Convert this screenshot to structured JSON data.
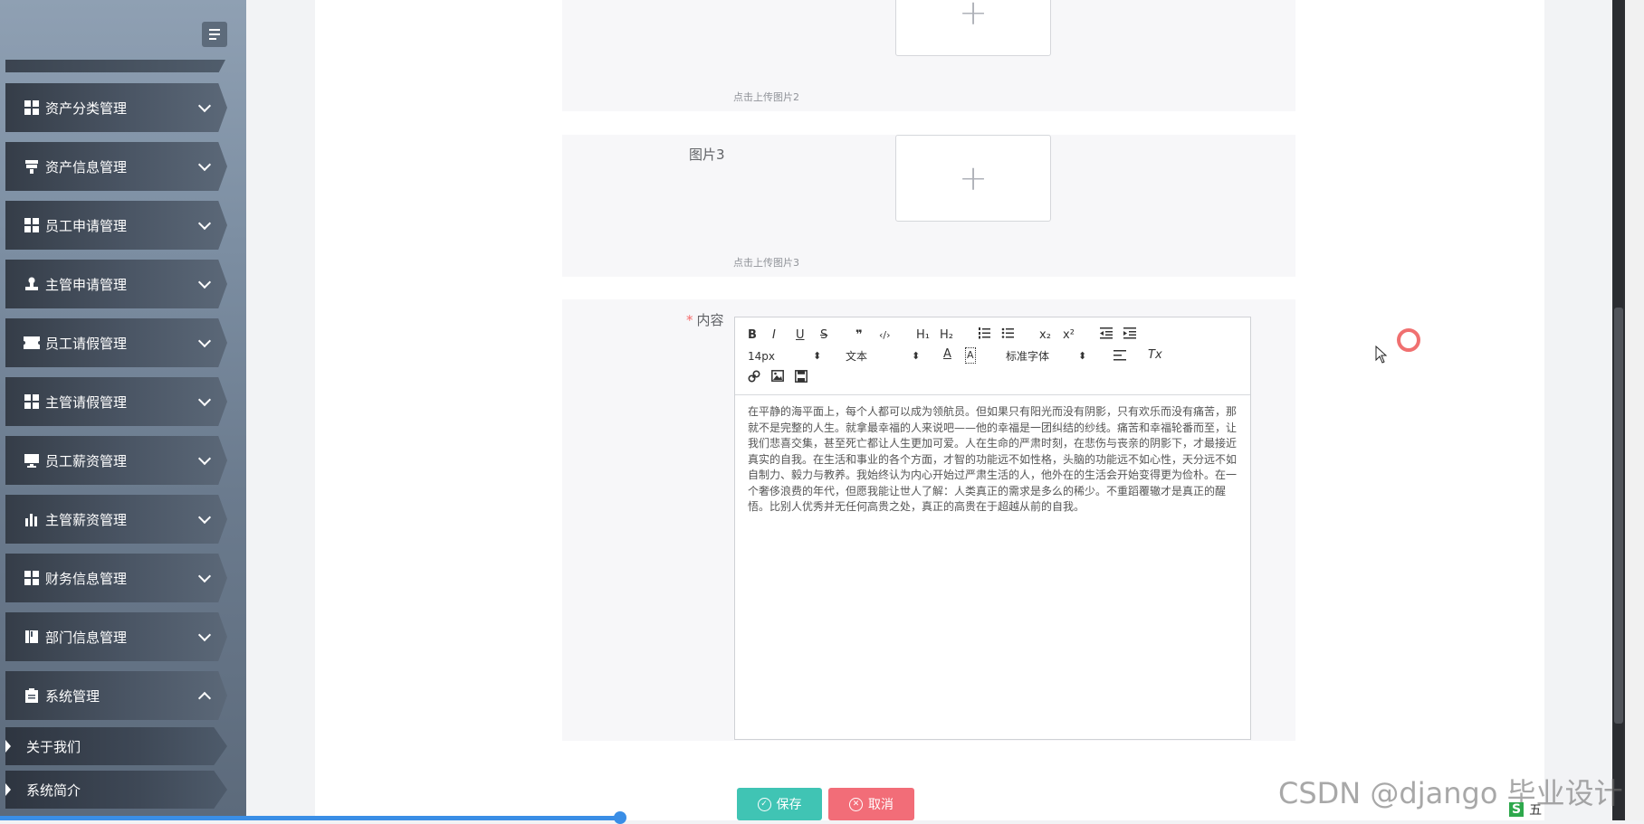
{
  "sidebar": {
    "menu": [
      {
        "label": "资产分类管理",
        "icon": "grid-icon",
        "expanded": false
      },
      {
        "label": "资产信息管理",
        "icon": "funnel-icon",
        "expanded": false
      },
      {
        "label": "员工申请管理",
        "icon": "grid-icon",
        "expanded": false
      },
      {
        "label": "主管申请管理",
        "icon": "stamp-icon",
        "expanded": false
      },
      {
        "label": "员工请假管理",
        "icon": "ticket-icon",
        "expanded": false
      },
      {
        "label": "主管请假管理",
        "icon": "grid-icon",
        "expanded": false
      },
      {
        "label": "员工薪资管理",
        "icon": "monitor-icon",
        "expanded": false
      },
      {
        "label": "主管薪资管理",
        "icon": "bar-chart-icon",
        "expanded": false
      },
      {
        "label": "财务信息管理",
        "icon": "grid-icon",
        "expanded": false
      },
      {
        "label": "部门信息管理",
        "icon": "book-icon",
        "expanded": false
      },
      {
        "label": "系统管理",
        "icon": "clipboard-icon",
        "expanded": true
      }
    ],
    "submenu": [
      "关于我们",
      "系统简介"
    ]
  },
  "form": {
    "image2_hint": "点击上传图片2",
    "image3_label": "图片3",
    "image3_hint": "点击上传图片3",
    "content_label": "内容",
    "content_required_mark": "*"
  },
  "editor": {
    "toolbar": {
      "bold": "B",
      "italic": "I",
      "underline": "U",
      "strike": "S",
      "quote": "❞",
      "code": "‹/›",
      "h1": "H₁",
      "h2": "H₂",
      "sub": "x₂",
      "sup": "x²",
      "size": "14px",
      "header": "文本",
      "font": "标准字体",
      "size_arrow": "⬍",
      "header_arrow": "⬍",
      "font_arrow": "⬍",
      "color": "A",
      "background": "A",
      "clean": "Tx"
    },
    "content": "在平静的海平面上，每个人都可以成为领航员。但如果只有阳光而没有阴影，只有欢乐而没有痛苦，那就不是完整的人生。就拿最幸福的人来说吧——他的幸福是一团纠结的纱线。痛苦和幸福轮番而至，让我们悲喜交集，甚至死亡都让人生更加可爱。人在生命的严肃时刻，在悲伤与丧亲的阴影下，才最接近真实的自我。在生活和事业的各个方面，才智的功能远不如性格，头脑的功能远不如心性，天分远不如自制力、毅力与教养。我始终认为内心开始过严肃生活的人，他外在的生活会开始变得更为俭朴。在一个奢侈浪费的年代，但愿我能让世人了解：人类真正的需求是多么的稀少。不重蹈覆辙才是真正的醒悟。比别人优秀并无任何高贵之处，真正的高贵在于超越从前的自我。"
  },
  "buttons": {
    "save": "保存",
    "cancel": "取消"
  },
  "upload_plus": "+",
  "watermark": "CSDN @django 毕业设计",
  "tray": {
    "ime": "五",
    "s": "S"
  },
  "colors": {
    "save_button": "#40c4b4",
    "cancel_button": "#f26d78",
    "required_mark": "#f56c6c"
  }
}
